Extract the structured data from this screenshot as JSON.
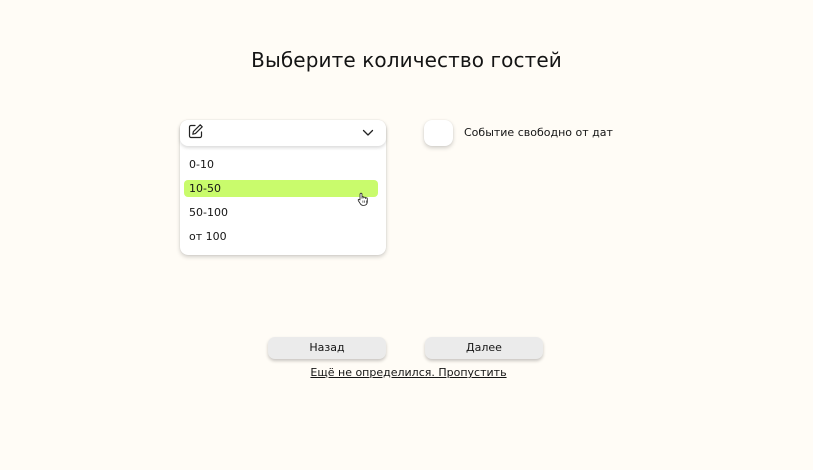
{
  "page": {
    "title": "Выберите количество гостей"
  },
  "guest_dropdown": {
    "icons": {
      "left": "edit-icon",
      "right": "chevron-down-icon"
    },
    "options": [
      "0-10",
      "10-50",
      "50-100",
      "от 100"
    ],
    "selected_index": 1,
    "selected_color": "#c9fb6c"
  },
  "date_toggle": {
    "label": "Событие свободно от дат",
    "checked": false
  },
  "actions": {
    "back_label": "Назад",
    "next_label": "Далее",
    "skip_label": "Ещё не определился. Пропустить"
  },
  "colors": {
    "background": "#fffcf6",
    "button": "#ebebeb",
    "accent": "#c9fb6c"
  },
  "cursor": {
    "icon": "hand-pointer-icon"
  }
}
